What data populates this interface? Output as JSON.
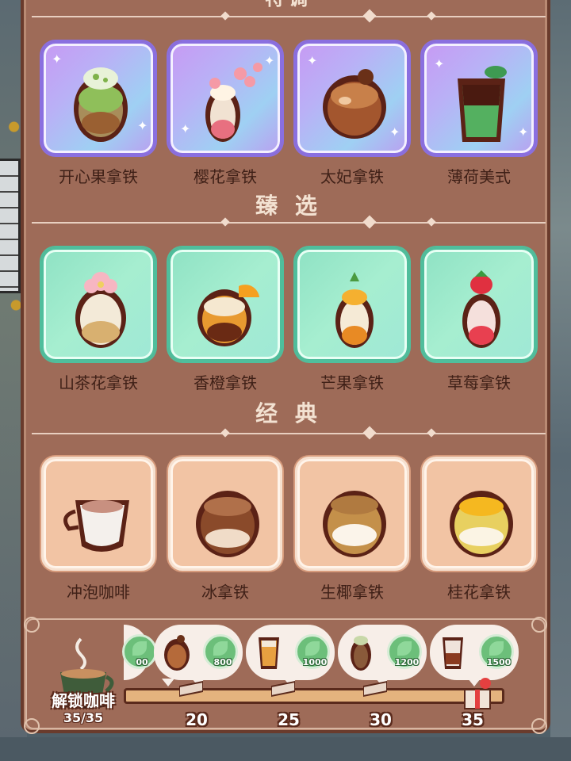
{
  "sections": {
    "rare_title": "特调",
    "select_title": "臻 选",
    "classic_title": "经 典"
  },
  "rare_drinks": [
    {
      "name": "开心果拿铁",
      "icon": "pistachio-latte-icon"
    },
    {
      "name": "樱花拿铁",
      "icon": "sakura-latte-icon"
    },
    {
      "name": "太妃拿铁",
      "icon": "toffee-latte-icon"
    },
    {
      "name": "薄荷美式",
      "icon": "mint-americano-icon"
    }
  ],
  "select_drinks": [
    {
      "name": "山茶花拿铁",
      "icon": "camellia-latte-icon"
    },
    {
      "name": "香橙拿铁",
      "icon": "orange-latte-icon"
    },
    {
      "name": "芒果拿铁",
      "icon": "mango-latte-icon"
    },
    {
      "name": "草莓拿铁",
      "icon": "strawberry-latte-icon"
    }
  ],
  "classic_drinks": [
    {
      "name": "冲泡咖啡",
      "icon": "brewed-coffee-icon"
    },
    {
      "name": "冰拿铁",
      "icon": "iced-latte-icon"
    },
    {
      "name": "生椰拿铁",
      "icon": "coconut-latte-icon"
    },
    {
      "name": "桂花拿铁",
      "icon": "osmanthus-latte-icon"
    }
  ],
  "progress": {
    "unlock_label": "解锁咖啡",
    "count": "35/35",
    "ticks": [
      "20",
      "25",
      "30",
      "35"
    ],
    "rewards": [
      "800",
      "1000",
      "1200",
      "1500"
    ],
    "partial_reward": "00",
    "fill_fraction": 1.0
  },
  "colors": {
    "panel": "#9e6b58",
    "rare_card": "#b9b1f6",
    "select_card": "#a6eed0",
    "classic_card": "#f2c4a4",
    "label_text": "#3f2017",
    "title_text": "#f3e2d2"
  }
}
